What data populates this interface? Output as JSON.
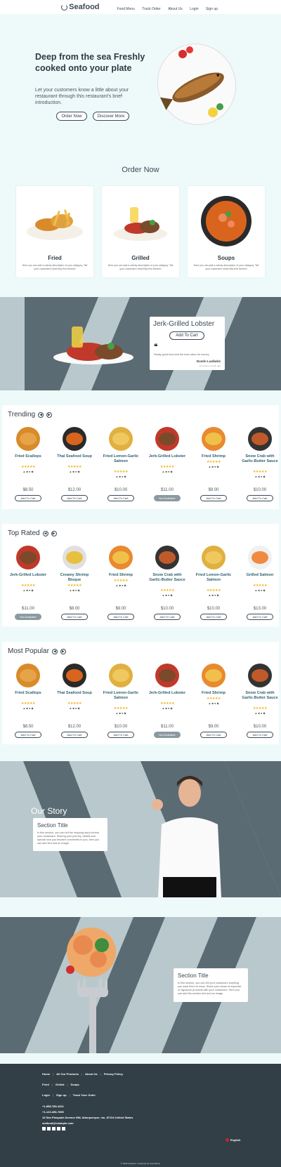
{
  "header": {
    "brand": "Seafood",
    "nav": [
      "Food Menu",
      "Track Order",
      "About Us",
      "Login",
      "Sign up"
    ]
  },
  "hero": {
    "heading": "Deep from the sea Freshly cooked onto your plate",
    "text": "Let your customers know a little about your restaurant through this restaurant's brief introduction.",
    "order_btn": "Order Now",
    "discover_btn": "Discover More"
  },
  "order_now": {
    "title": "Order Now",
    "categories": [
      {
        "title": "Fried",
        "desc": "Here you can add a catchy description of your category. Tell your customers what they find therein!"
      },
      {
        "title": "Grilled",
        "desc": "Here you can add a catchy description of your category. Tell your customers what they find therein!"
      },
      {
        "title": "Soups",
        "desc": "Here you can add a catchy description of your category. Tell your customers what they find therein!"
      }
    ]
  },
  "featured": {
    "title": "Jerk-Grilled Lobster",
    "cart_btn": "Add To Cart",
    "quote": "Really good food and the best value for money",
    "author": "Dustin Lueilwitz",
    "when": "more than a month ago"
  },
  "trending": {
    "title": "Trending",
    "items": [
      {
        "name": "Fried Scallops",
        "price": "$8.50",
        "btn": "Add To Cart",
        "available": true
      },
      {
        "name": "Thai Seafood Soup",
        "price": "$12.00",
        "btn": "Add To Cart",
        "available": true
      },
      {
        "name": "Fried Lemon-Garlic Salmon",
        "price": "$10.00",
        "btn": "Add To Cart",
        "available": true
      },
      {
        "name": "Jerk-Grilled Lobster",
        "price": "$11.00",
        "btn": "Not Available",
        "available": false
      },
      {
        "name": "Fried Shrimp",
        "price": "$9.00",
        "btn": "Add To Cart",
        "available": true
      },
      {
        "name": "Snow Crab with Garlic-Butter Sauce",
        "price": "$10.00",
        "btn": "Add To Cart",
        "available": true
      }
    ]
  },
  "top_rated": {
    "title": "Top Rated",
    "items": [
      {
        "name": "Jerk-Grilled Lobster",
        "price": "$11.00",
        "btn": "Not Available",
        "available": false
      },
      {
        "name": "Creamy Shrimp Bisque",
        "price": "$8.00",
        "btn": "Add To Cart",
        "available": true
      },
      {
        "name": "Fried Shrimp",
        "price": "$9.00",
        "btn": "Add To Cart",
        "available": true
      },
      {
        "name": "Snow Crab with Garlic-Butter Sauce",
        "price": "$10.00",
        "btn": "Add To Cart",
        "available": true
      },
      {
        "name": "Fried Lemon-Garlic Salmon",
        "price": "$10.00",
        "btn": "Add To Cart",
        "available": true
      },
      {
        "name": "Grilled Salmon",
        "price": "$13.00",
        "btn": "Add To Cart",
        "available": true
      }
    ]
  },
  "most_popular": {
    "title": "Most Popular",
    "items": [
      {
        "name": "Fried Scallops",
        "price": "$8.50",
        "btn": "Add To Cart",
        "available": true
      },
      {
        "name": "Thai Seafood Soup",
        "price": "$12.00",
        "btn": "Add To Cart",
        "available": true
      },
      {
        "name": "Fried Lemon-Garlic Salmon",
        "price": "$10.00",
        "btn": "Add To Cart",
        "available": true
      },
      {
        "name": "Jerk-Grilled Lobster",
        "price": "$11.00",
        "btn": "Not Available",
        "available": false
      },
      {
        "name": "Fried Shrimp",
        "price": "$9.00",
        "btn": "Add To Cart",
        "available": true
      },
      {
        "name": "Snow Crab with Garlic-Butter Sauce",
        "price": "$10.00",
        "btn": "Add To Cart",
        "available": true
      }
    ]
  },
  "story": {
    "heading": "Our Story",
    "card_title": "Section Title",
    "card_text": "In this section, you can tell the inspiring story behind your restaurant. Sharing your journey, details and special how you became connected to you, then you can add text and an image."
  },
  "story2": {
    "card_title": "Section Title",
    "card_text": "In this section, you can tell your customers anything you want them to know. Share your areas of expertise or signature products with your customers. Here you can add the section text and an image."
  },
  "footer": {
    "row1": [
      "Home",
      "All Our Products",
      "About Us",
      "Privacy Policy"
    ],
    "row2": [
      "Fried",
      "Grilled",
      "Soups"
    ],
    "row3": [
      "Login",
      "Sign up",
      "Track Your Order"
    ],
    "phone1": "+1-858-785-4321",
    "phone2": "+1-123-456-7890",
    "address": "16 San Pasquale Avenue NW, Albuquerque, nm, 87104 United States",
    "email": "seafood@example.com",
    "language": "English",
    "copyright": "© 2023 Seafood - Powered by Food Menu"
  },
  "colors": {
    "bg": "#eefafa",
    "dark": "#5b6b73",
    "light": "#b9c8cc",
    "star": "#f2b01e",
    "footer": "#333f47"
  }
}
